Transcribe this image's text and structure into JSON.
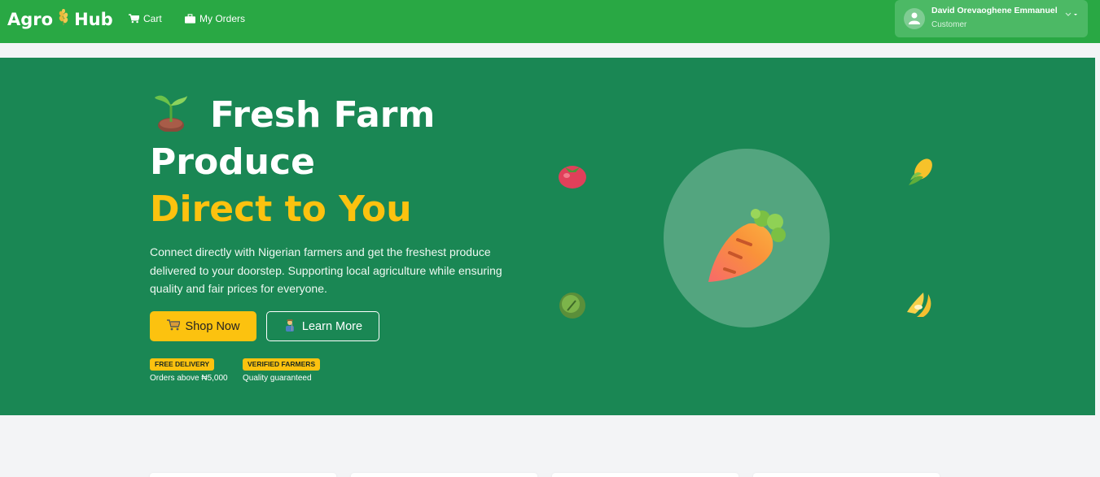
{
  "brand": {
    "name_part1": "Agro",
    "name_part2": "Hub",
    "logo_icon": "wheat-icon"
  },
  "nav": {
    "cart_label": "Cart",
    "orders_label": "My Orders"
  },
  "user": {
    "name": "David Orevaoghene Emmanuel",
    "role": "Customer"
  },
  "hero": {
    "title_line1": "Fresh Farm",
    "title_line2": "Produce",
    "title_highlight": "Direct to You",
    "description": "Connect directly with Nigerian farmers and get the freshest produce delivered to your doorstep. Supporting local agriculture while ensuring quality and fair prices for everyone.",
    "shop_button": "Shop Now",
    "learn_button": "Learn More",
    "badges": [
      {
        "label": "FREE DELIVERY",
        "sub": "Orders above ₦5,000"
      },
      {
        "label": "VERIFIED FARMERS",
        "sub": "Quality guaranteed"
      }
    ]
  },
  "colors": {
    "navbar": "#29a844",
    "hero": "#1a8754",
    "accent": "#fcc20f"
  }
}
